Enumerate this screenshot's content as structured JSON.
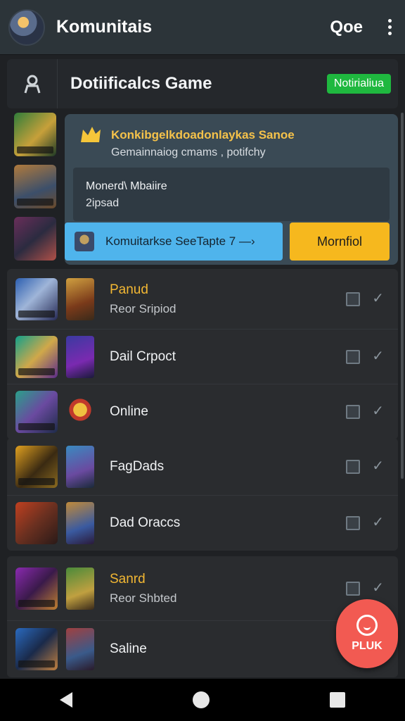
{
  "app_bar": {
    "title": "Komunitais",
    "action_label": "Qoe"
  },
  "section": {
    "title": "Dotiificalcs Game",
    "badge": "Notirialiua"
  },
  "featured_card": {
    "title": "Konkibgelkdoadonlaykas Sanoe",
    "subtitle": "Gemainnaiog cmams , potifchy",
    "line1": "Monerd\\ Mbaiire",
    "line2": "2ipsad",
    "cta_label": "Komuitarkse SeeTapte 7 —›",
    "button_label": "Mornfiol"
  },
  "list_groups": [
    {
      "rows": [
        {
          "name": "Panud",
          "sub": "Reor Sripiod",
          "highlight": true
        },
        {
          "name": "Dail Crpoct",
          "sub": "",
          "highlight": false
        },
        {
          "name": "Online",
          "sub": "",
          "highlight": false
        }
      ]
    },
    {
      "rows": [
        {
          "name": "FagDads",
          "sub": "",
          "highlight": false
        },
        {
          "name": "Dad Oraccs",
          "sub": "",
          "highlight": false
        }
      ]
    },
    {
      "rows": [
        {
          "name": "Sanrd",
          "sub": "Reor Shbted",
          "highlight": true
        },
        {
          "name": "Saline",
          "sub": "",
          "highlight": false
        }
      ]
    }
  ],
  "fab": {
    "label": "PLUK"
  },
  "colors": {
    "accent_green": "#1fb83f",
    "accent_yellow": "#f6b81e",
    "accent_blue": "#4fb4ec",
    "fab_red": "#f25a52",
    "gold_text": "#f2b733"
  }
}
